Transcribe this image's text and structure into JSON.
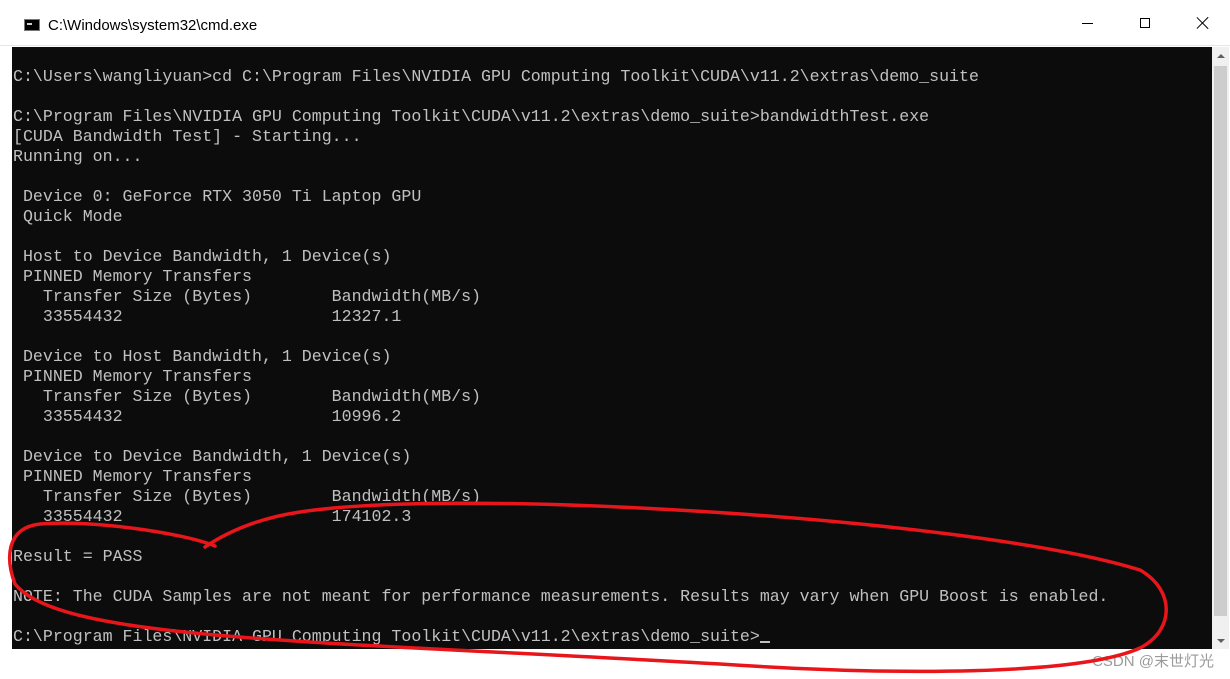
{
  "window": {
    "title": "C:\\Windows\\system32\\cmd.exe",
    "icon": "cmd-icon",
    "controls": {
      "minimize": "minimize-icon",
      "maximize": "maximize-icon",
      "close": "close-icon"
    }
  },
  "console": {
    "lines": [
      "C:\\Users\\wangliyuan>cd C:\\Program Files\\NVIDIA GPU Computing Toolkit\\CUDA\\v11.2\\extras\\demo_suite",
      "",
      "C:\\Program Files\\NVIDIA GPU Computing Toolkit\\CUDA\\v11.2\\extras\\demo_suite>bandwidthTest.exe",
      "[CUDA Bandwidth Test] - Starting...",
      "Running on...",
      "",
      " Device 0: GeForce RTX 3050 Ti Laptop GPU",
      " Quick Mode",
      "",
      " Host to Device Bandwidth, 1 Device(s)",
      " PINNED Memory Transfers",
      "   Transfer Size (Bytes)        Bandwidth(MB/s)",
      "   33554432                     12327.1",
      "",
      " Device to Host Bandwidth, 1 Device(s)",
      " PINNED Memory Transfers",
      "   Transfer Size (Bytes)        Bandwidth(MB/s)",
      "   33554432                     10996.2",
      "",
      " Device to Device Bandwidth, 1 Device(s)",
      " PINNED Memory Transfers",
      "   Transfer Size (Bytes)        Bandwidth(MB/s)",
      "   33554432                     174102.3",
      "",
      "Result = PASS",
      "",
      "NOTE: The CUDA Samples are not meant for performance measurements. Results may vary when GPU Boost is enabled.",
      ""
    ],
    "prompt": "C:\\Program Files\\NVIDIA GPU Computing Toolkit\\CUDA\\v11.2\\extras\\demo_suite>",
    "colors": {
      "background": "#0c0c0c",
      "foreground": "#c0c0c0",
      "annotation": "#e8151b"
    }
  },
  "watermark": "CSDN @末世灯光"
}
